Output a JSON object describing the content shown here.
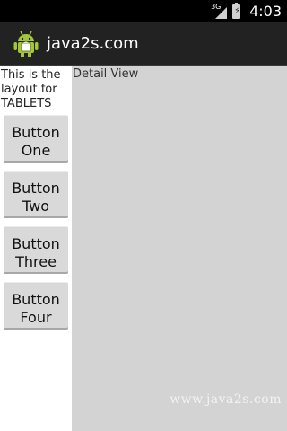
{
  "status_bar": {
    "network": "3G",
    "time": "4:03",
    "icons": [
      "signal-icon",
      "battery-charging-icon"
    ]
  },
  "action_bar": {
    "title": "java2s.com",
    "icon": "android-robot-icon"
  },
  "left_pane": {
    "description": "This is the layout for TABLETS",
    "buttons": [
      {
        "label": "Button One"
      },
      {
        "label": "Button Two"
      },
      {
        "label": "Button Three"
      },
      {
        "label": "Button Four"
      }
    ]
  },
  "detail_pane": {
    "label": "Detail View",
    "watermark": "www.java2s.com"
  },
  "colors": {
    "status_bar": "#000000",
    "action_bar": "#222222",
    "detail_background": "#d3d3d3",
    "button_background": "#d9d9d9",
    "android_green": "#a4c639"
  }
}
